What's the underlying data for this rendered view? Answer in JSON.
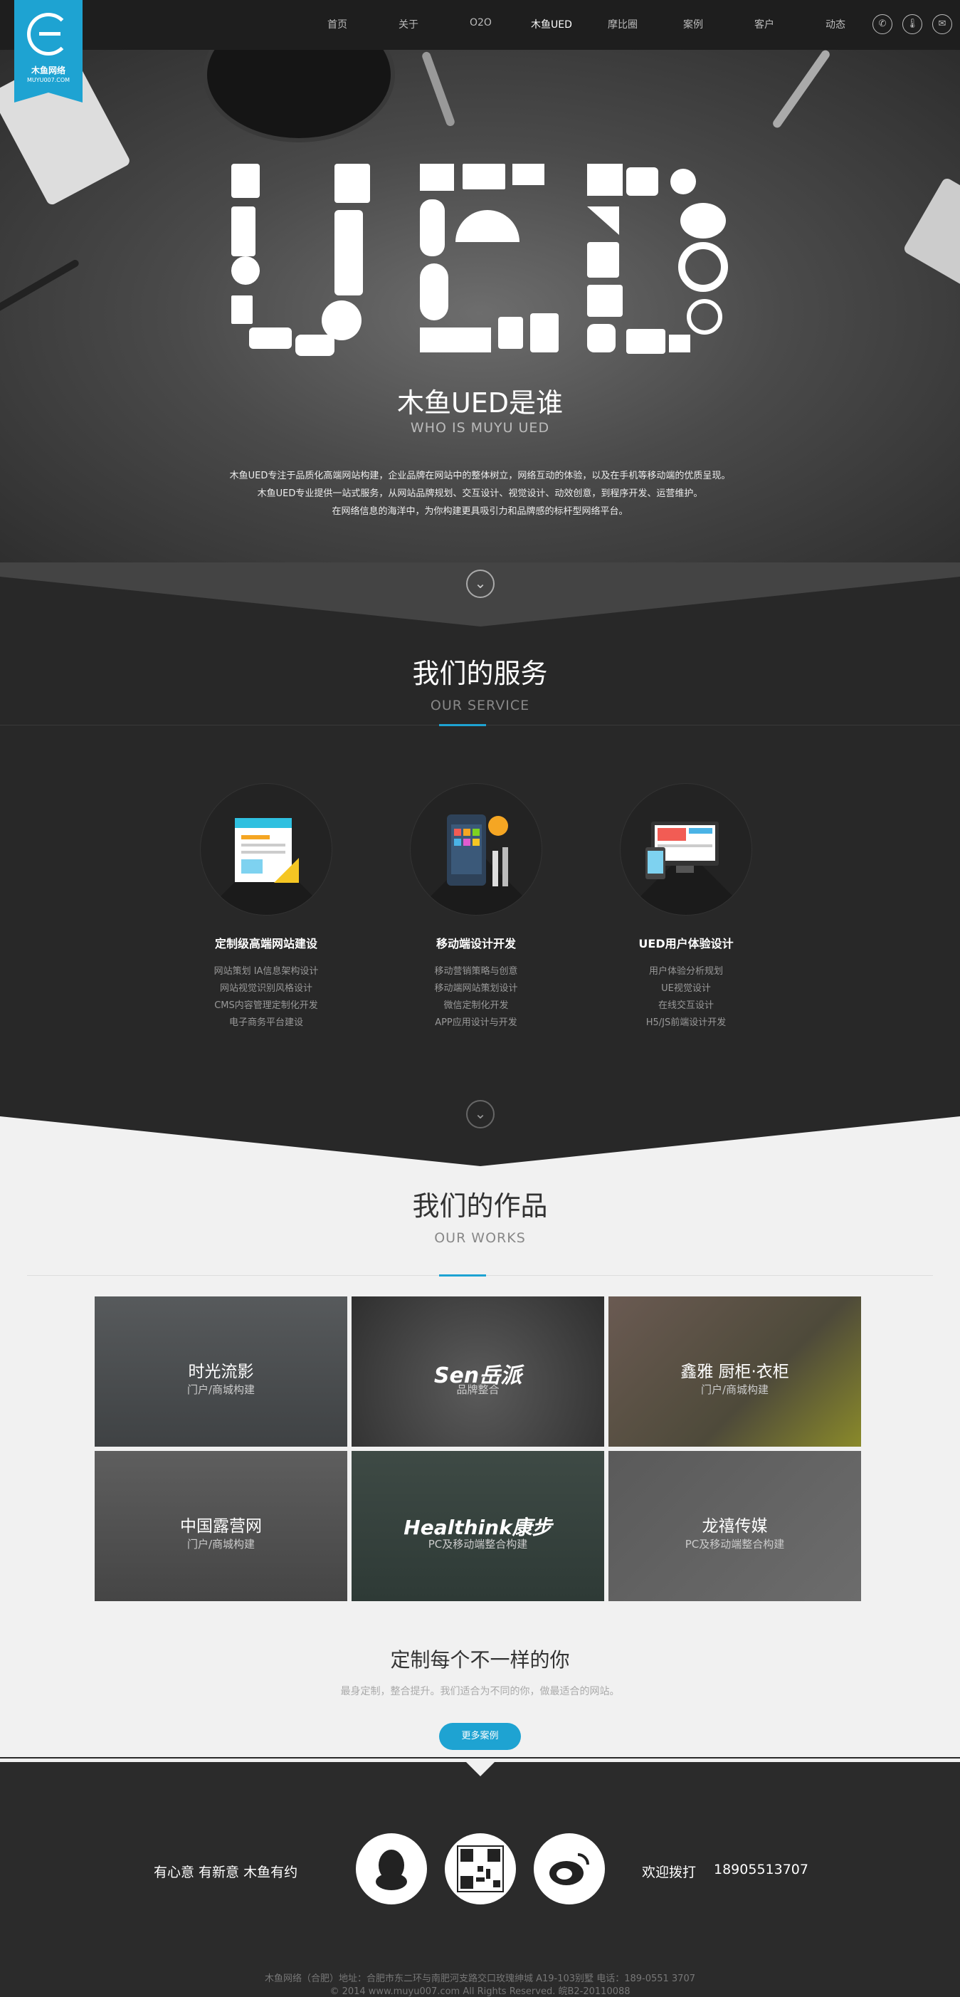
{
  "brand": {
    "name": "木鱼网络",
    "domain": "MUYU007.COM",
    "color": "#1ea3d2"
  },
  "nav": {
    "items": [
      "首页",
      "关于",
      "O2O",
      "木鱼UED",
      "摩比圈",
      "案例",
      "客户",
      "动态"
    ],
    "active": "木鱼UED",
    "icons": [
      "phone-icon",
      "thermometer-icon",
      "chat-icon"
    ]
  },
  "hero": {
    "big_text": "UED",
    "title": "木鱼UED是谁",
    "subtitle": "WHO IS MUYU UED",
    "paragraphs": [
      "木鱼UED专注于品质化高端网站构建，企业品牌在网站中的整体树立，网络互动的体验，以及在手机等移动端的优质呈现。",
      "木鱼UED专业提供一站式服务，从网站品牌规划、交互设计、视觉设计、动效创意，到程序开发、运营维护。",
      "在网络信息的海洋中，为你构建更具吸引力和品牌感的标杆型网络平台。"
    ]
  },
  "service": {
    "title": "我们的服务",
    "subtitle": "OUR SERVICE",
    "items": [
      {
        "title": "定制级高端网站建设",
        "lines": [
          "网站策划 IA信息架构设计",
          "网站视觉识别风格设计",
          "CMS内容管理定制化开发",
          "电子商务平台建设"
        ]
      },
      {
        "title": "移动端设计开发",
        "lines": [
          "移动营销策略与创意",
          "移动端网站策划设计",
          "微信定制化开发",
          "APP应用设计与开发"
        ]
      },
      {
        "title": "UED用户体验设计",
        "lines": [
          "用户体验分析规划",
          "UE视觉设计",
          "在线交互设计",
          "H5/JS前端设计开发"
        ]
      }
    ]
  },
  "works": {
    "title": "我们的作品",
    "subtitle": "OUR WORKS",
    "tiles": [
      {
        "title": "时光流影",
        "tag": "门户/商城构建"
      },
      {
        "title": "Sen岳派",
        "tag": "品牌整合"
      },
      {
        "title": "鑫雅 厨柜·衣柜",
        "tag": "门户/商城构建"
      },
      {
        "title": "中国露营网",
        "tag": "门户/商城构建"
      },
      {
        "title": "Healthink康步",
        "tag": "PC及移动端整合构建"
      },
      {
        "title": "龙禧传媒",
        "tag": "PC及移动端整合构建"
      }
    ],
    "cta_title": "定制每个不一样的你",
    "cta_sub": "最身定制，整合提升。我们适合为不同的你，做最适合的网站。",
    "cta_button": "更多案例"
  },
  "footer": {
    "slogan": "有心意 有新意 木鱼有约",
    "hotline_label": "欢迎拨打",
    "hotline": "18905513707",
    "icons": [
      "qq-icon",
      "qrcode-icon",
      "weibo-icon"
    ],
    "address": "木鱼网络（合肥）地址：合肥市东二环与南肥河支路交口玫瑰绅城 A19-103别墅 电话：189-0551 3707",
    "copyright": "© 2014 www.muyu007.com All Rights Reserved. 皖B2-20110088"
  }
}
